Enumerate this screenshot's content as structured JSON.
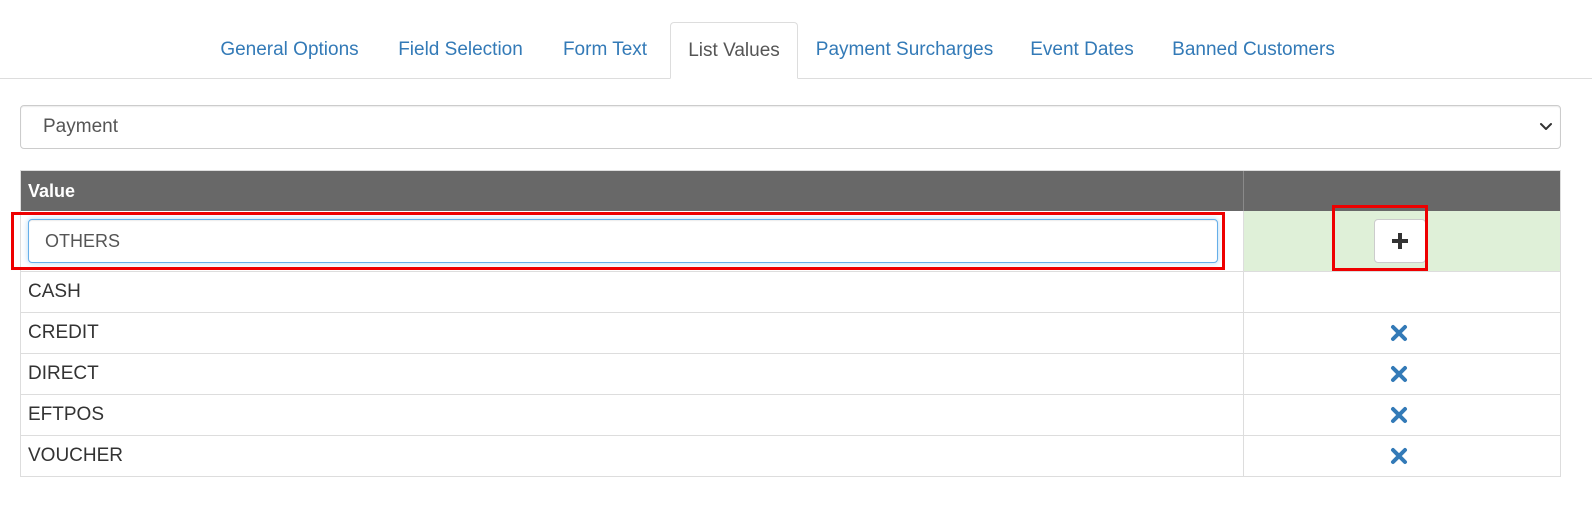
{
  "tabs": [
    {
      "label": "General Options",
      "active": false
    },
    {
      "label": "Field Selection",
      "active": false
    },
    {
      "label": "Form Text",
      "active": false
    },
    {
      "label": "List Values",
      "active": true
    },
    {
      "label": "Payment Surcharges",
      "active": false
    },
    {
      "label": "Event Dates",
      "active": false
    },
    {
      "label": "Banned Customers",
      "active": false
    }
  ],
  "list_select": {
    "selected": "Payment"
  },
  "table": {
    "header_value": "Value",
    "new_value": "OTHERS",
    "rows": [
      {
        "value": "CASH",
        "removable": false
      },
      {
        "value": "CREDIT",
        "removable": true
      },
      {
        "value": "DIRECT",
        "removable": true
      },
      {
        "value": "EFTPOS",
        "removable": true
      },
      {
        "value": "VOUCHER",
        "removable": true
      }
    ]
  },
  "icons": {
    "add": "plus-icon",
    "remove": "x-icon",
    "select": "chevron-down-icon"
  },
  "colors": {
    "link": "#337ab7",
    "header_bg": "#686868",
    "new_row_bg": "#dff0d8",
    "remove_icon": "#337ab7",
    "highlight": "#ee0000"
  }
}
